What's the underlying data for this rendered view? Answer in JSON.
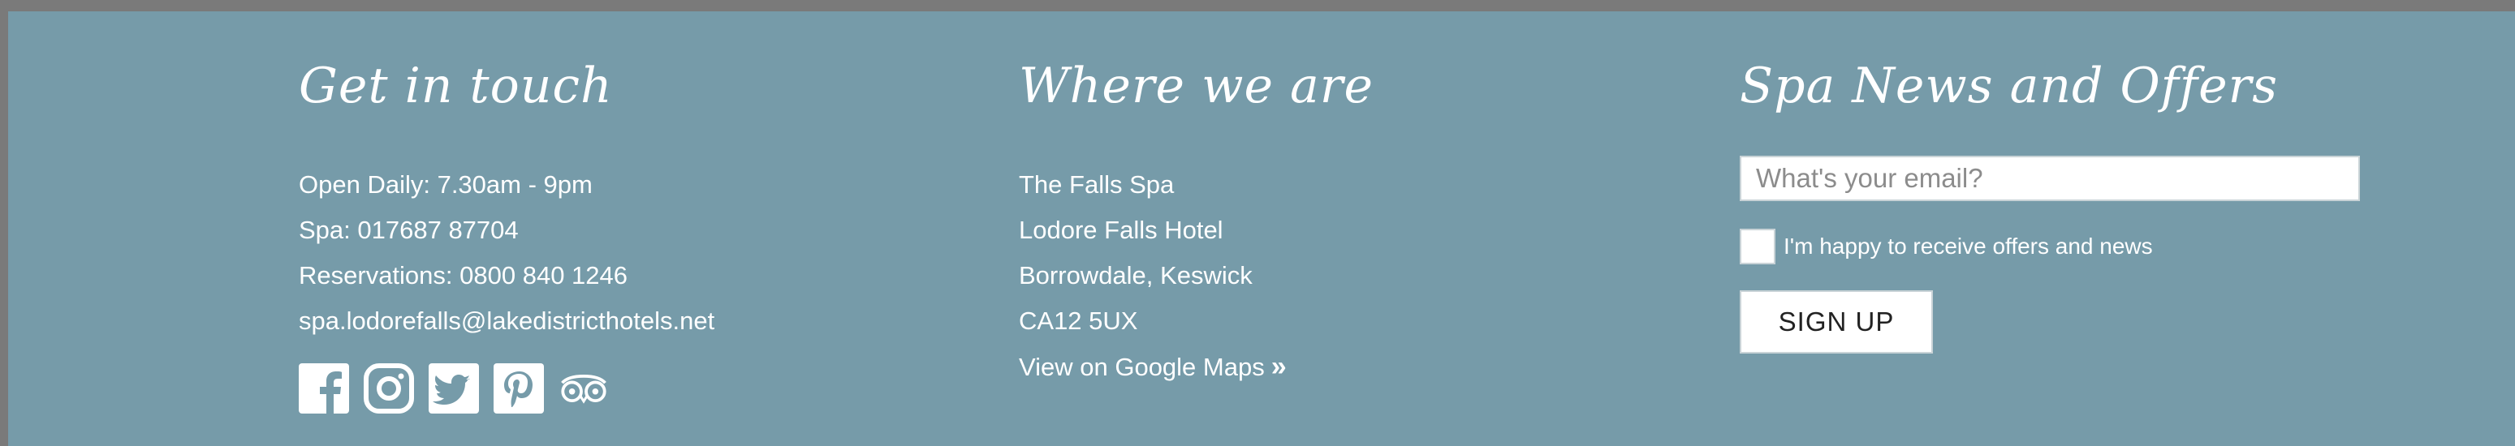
{
  "contact": {
    "heading": "Get in touch",
    "hours": "Open Daily: 7.30am - 9pm",
    "spa_phone": "Spa: 017687 87704",
    "reservations": "Reservations: 0800 840 1246",
    "email": "spa.lodorefalls@lakedistricthotels.net",
    "socials": [
      {
        "name": "facebook-icon"
      },
      {
        "name": "instagram-icon"
      },
      {
        "name": "twitter-icon"
      },
      {
        "name": "pinterest-icon"
      },
      {
        "name": "tripadvisor-icon"
      }
    ]
  },
  "location": {
    "heading": "Where we are",
    "address": [
      "The Falls Spa",
      "Lodore Falls Hotel",
      "Borrowdale, Keswick",
      "CA12 5UX"
    ],
    "maps_link": "View on Google Maps",
    "maps_icon": "double-chevron-right-icon"
  },
  "newsletter": {
    "heading": "Spa News and Offers",
    "email_placeholder": "What's your email?",
    "consent_label": "I'm happy to receive offers and news",
    "signup_label": "SIGN UP"
  },
  "colors": {
    "footer_bg": "#769ba9",
    "text": "#ffffff",
    "frame": "#7a7a7a"
  }
}
